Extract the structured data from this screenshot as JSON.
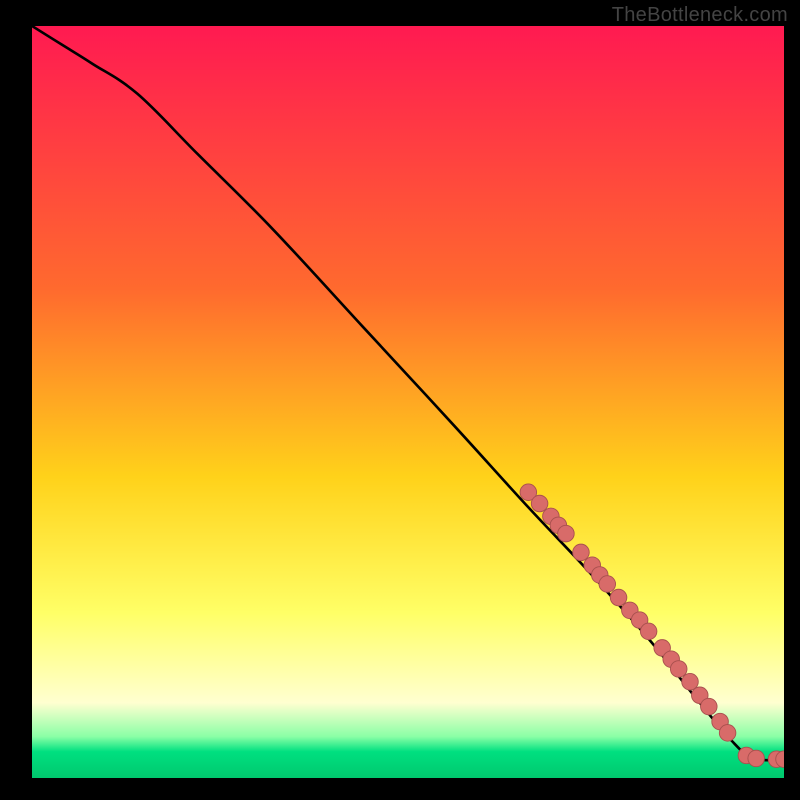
{
  "watermark": "TheBottleneck.com",
  "colors": {
    "bg": "#000000",
    "watermark": "#444444",
    "curve": "#000000",
    "marker_fill": "#d86b69",
    "marker_stroke": "#a8504e",
    "grad_top": "#ff1a51",
    "grad_upper_mid": "#ff6a2e",
    "grad_mid": "#ffd21a",
    "grad_lower_mid": "#ffff66",
    "grad_pale": "#ffffd0",
    "grad_green1": "#8affa6",
    "grad_green2": "#00e080",
    "grad_bottom": "#00c86e"
  },
  "gradient_stops": [
    {
      "offset": 0.0,
      "color_key": "grad_top"
    },
    {
      "offset": 0.35,
      "color_key": "grad_upper_mid"
    },
    {
      "offset": 0.6,
      "color_key": "grad_mid"
    },
    {
      "offset": 0.78,
      "color_key": "grad_lower_mid"
    },
    {
      "offset": 0.9,
      "color_key": "grad_pale"
    },
    {
      "offset": 0.945,
      "color_key": "grad_green1"
    },
    {
      "offset": 0.965,
      "color_key": "grad_green2"
    },
    {
      "offset": 1.0,
      "color_key": "grad_bottom"
    }
  ],
  "chart_data": {
    "type": "line",
    "title": "",
    "xlabel": "",
    "ylabel": "",
    "xlim": [
      0,
      100
    ],
    "ylim": [
      0,
      100
    ],
    "series": [
      {
        "name": "curve",
        "x": [
          0,
          4,
          8,
          14,
          22,
          32,
          44,
          56,
          66,
          74,
          82,
          88,
          93,
          96,
          100
        ],
        "y": [
          100,
          97.5,
          95,
          91,
          83,
          73,
          60,
          47,
          36,
          27.5,
          18.5,
          11,
          5,
          2.6,
          2.5
        ]
      }
    ],
    "markers": [
      {
        "x": 66.0,
        "y": 38.0
      },
      {
        "x": 67.5,
        "y": 36.5
      },
      {
        "x": 69.0,
        "y": 34.8
      },
      {
        "x": 70.0,
        "y": 33.6
      },
      {
        "x": 71.0,
        "y": 32.5
      },
      {
        "x": 73.0,
        "y": 30.0
      },
      {
        "x": 74.5,
        "y": 28.3
      },
      {
        "x": 75.5,
        "y": 27.0
      },
      {
        "x": 76.5,
        "y": 25.8
      },
      {
        "x": 78.0,
        "y": 24.0
      },
      {
        "x": 79.5,
        "y": 22.3
      },
      {
        "x": 80.8,
        "y": 21.0
      },
      {
        "x": 82.0,
        "y": 19.5
      },
      {
        "x": 83.8,
        "y": 17.3
      },
      {
        "x": 85.0,
        "y": 15.8
      },
      {
        "x": 86.0,
        "y": 14.5
      },
      {
        "x": 87.5,
        "y": 12.8
      },
      {
        "x": 88.8,
        "y": 11.0
      },
      {
        "x": 90.0,
        "y": 9.5
      },
      {
        "x": 91.5,
        "y": 7.5
      },
      {
        "x": 92.5,
        "y": 6.0
      },
      {
        "x": 95.0,
        "y": 3.0
      },
      {
        "x": 96.3,
        "y": 2.6
      },
      {
        "x": 99.0,
        "y": 2.5
      },
      {
        "x": 100.0,
        "y": 2.5
      }
    ],
    "marker_radius": 1.1
  }
}
